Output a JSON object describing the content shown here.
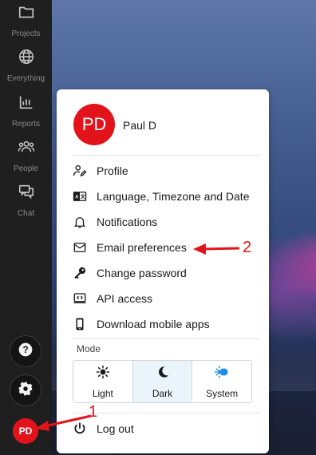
{
  "sidebar": {
    "items": [
      {
        "label": "Projects",
        "icon": "folder-icon"
      },
      {
        "label": "Everything",
        "icon": "globe-icon"
      },
      {
        "label": "Reports",
        "icon": "bar-chart-icon"
      },
      {
        "label": "People",
        "icon": "people-icon"
      },
      {
        "label": "Chat",
        "icon": "chat-icon"
      }
    ],
    "help_icon": "question-icon",
    "settings_icon": "gear-icon",
    "avatar_initials": "PD"
  },
  "menu": {
    "avatar_initials": "PD",
    "user_name": "Paul D",
    "items": [
      {
        "label": "Profile",
        "icon": "user-edit-icon"
      },
      {
        "label": "Language, Timezone and Date",
        "icon": "language-icon"
      },
      {
        "label": "Notifications",
        "icon": "bell-icon"
      },
      {
        "label": "Email preferences",
        "icon": "envelope-icon"
      },
      {
        "label": "Change password",
        "icon": "key-icon"
      },
      {
        "label": "API access",
        "icon": "api-icon"
      },
      {
        "label": "Download mobile apps",
        "icon": "mobile-icon"
      }
    ],
    "mode": {
      "label": "Mode",
      "options": [
        {
          "label": "Light",
          "icon": "sun-icon"
        },
        {
          "label": "Dark",
          "icon": "moon-icon"
        },
        {
          "label": "System",
          "icon": "system-icon"
        }
      ],
      "selected": "Dark"
    },
    "logout_label": "Log out"
  },
  "annotations": {
    "arrow_1_label": "1",
    "arrow_2_label": "2",
    "color": "#e3131b"
  },
  "colors": {
    "sidebar": "#1f1f1f",
    "avatar": "#e3131b",
    "mode_selected": "#e9f4fb",
    "system_icon": "#1e8fe6"
  }
}
